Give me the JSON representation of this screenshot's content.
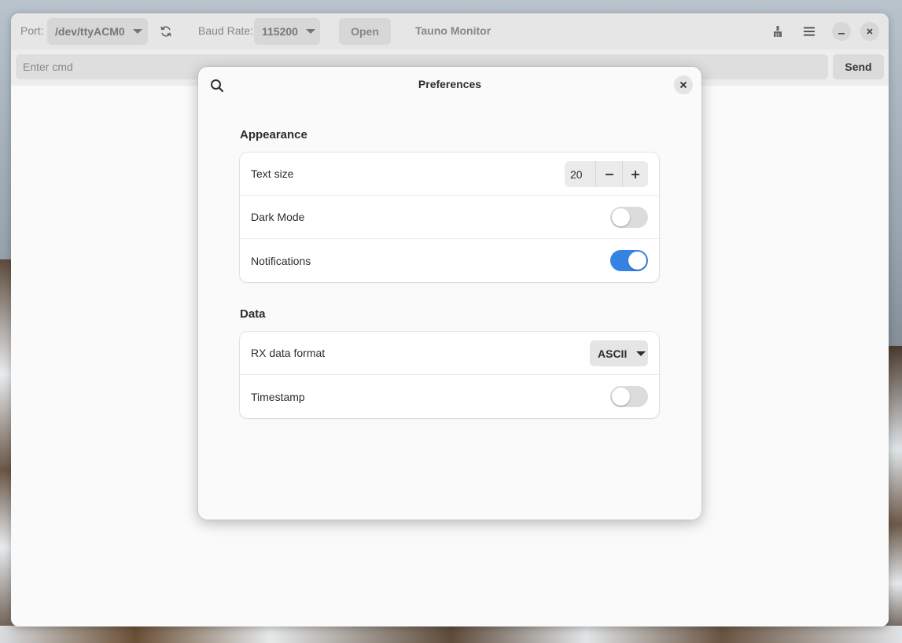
{
  "window": {
    "app_title": "Tauno Monitor"
  },
  "header": {
    "port_label": "Port:",
    "port_value": "/dev/ttyACM0",
    "baud_label": "Baud Rate:",
    "baud_value": "115200",
    "open_label": "Open"
  },
  "command": {
    "placeholder": "Enter cmd",
    "send_label": "Send"
  },
  "preferences": {
    "title": "Preferences",
    "appearance": {
      "title": "Appearance",
      "text_size_label": "Text size",
      "text_size_value": "20",
      "dark_mode_label": "Dark Mode",
      "dark_mode_on": false,
      "notifications_label": "Notifications",
      "notifications_on": true
    },
    "data": {
      "title": "Data",
      "rx_format_label": "RX data format",
      "rx_format_value": "ASCII",
      "timestamp_label": "Timestamp",
      "timestamp_on": false
    }
  },
  "colors": {
    "accent": "#3584e4"
  }
}
